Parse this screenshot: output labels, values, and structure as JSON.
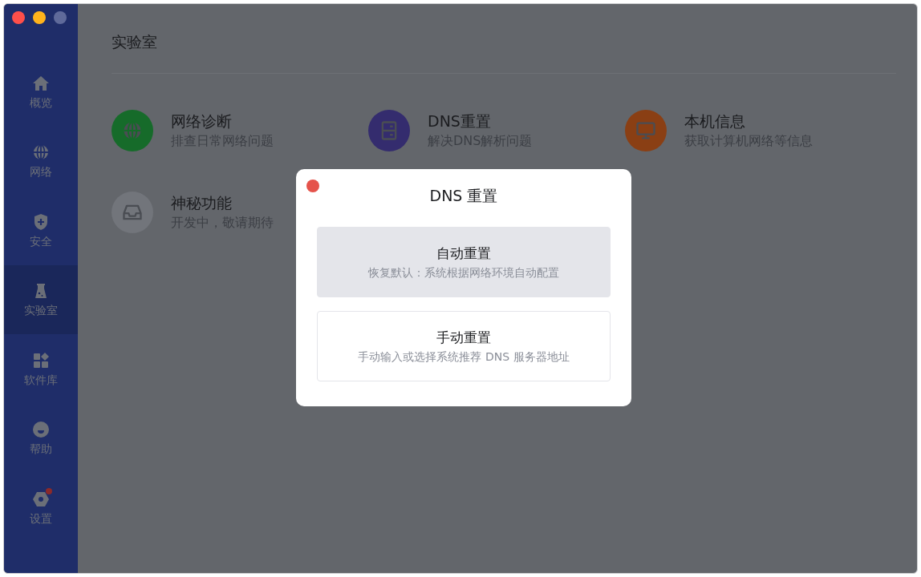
{
  "sidebar": {
    "items": [
      {
        "kind": "home",
        "label": "概览",
        "selected": false,
        "badge": false
      },
      {
        "kind": "globe",
        "label": "网络",
        "selected": false,
        "badge": false
      },
      {
        "kind": "shield",
        "label": "安全",
        "selected": false,
        "badge": false
      },
      {
        "kind": "flask",
        "label": "实验室",
        "selected": true,
        "badge": false
      },
      {
        "kind": "apps",
        "label": "软件库",
        "selected": false,
        "badge": false
      },
      {
        "kind": "smile",
        "label": "帮助",
        "selected": false,
        "badge": false
      },
      {
        "kind": "gear",
        "label": "设置",
        "selected": false,
        "badge": true
      }
    ]
  },
  "page_title": "实验室",
  "tools": [
    {
      "kind": "globe",
      "title": "网络诊断",
      "subtitle": "排查日常网络问题",
      "color": "#166b2a"
    },
    {
      "kind": "server",
      "title": "DNS重置",
      "subtitle": "解决DNS解析问题",
      "color": "#342c6e"
    },
    {
      "kind": "monitor",
      "title": "本机信息",
      "subtitle": "获取计算机网络等信息",
      "color": "#8a3f14"
    },
    {
      "kind": "inbox",
      "title": "神秘功能",
      "subtitle": "开发中，敬请期待",
      "color": "#72757b"
    }
  ],
  "dialog": {
    "title": "DNS 重置",
    "options": [
      {
        "title": "自动重置",
        "description": "恢复默认：系统根据网络环境自动配置",
        "selected": true
      },
      {
        "title": "手动重置",
        "description": "手动输入或选择系统推荐 DNS 服务器地址",
        "selected": false
      }
    ]
  }
}
